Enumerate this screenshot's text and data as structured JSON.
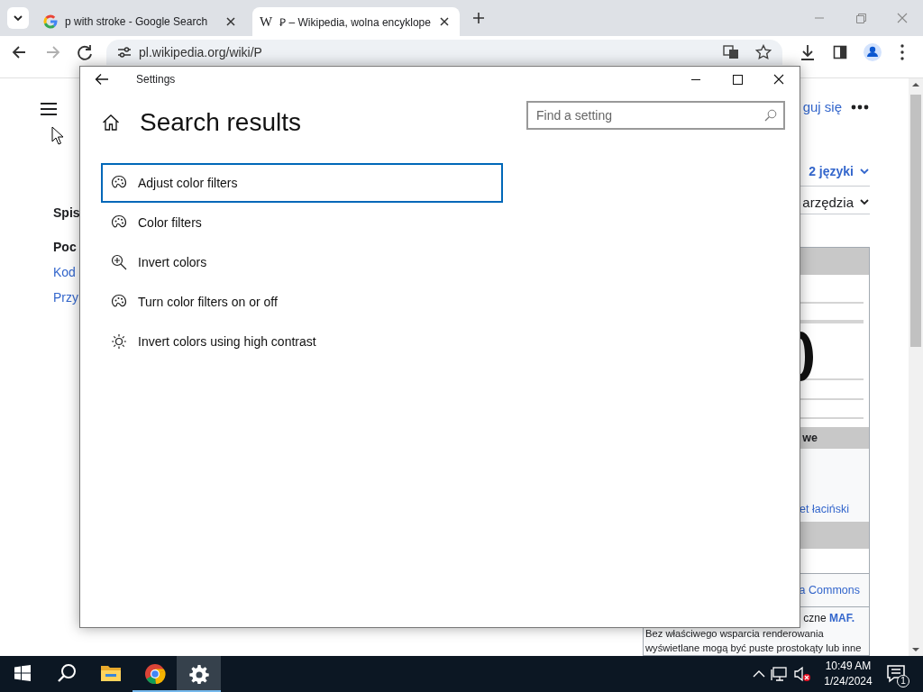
{
  "browser": {
    "tabs": [
      {
        "title": "p with stroke - Google Search",
        "selected": false
      },
      {
        "favicon": "W",
        "title": "Ꝑ – Wikipedia, wolna encyklope",
        "selected": true
      }
    ],
    "navigation": [
      {
        "kind": "back",
        "disabled": false
      },
      {
        "kind": "forward",
        "disabled": true
      },
      {
        "kind": "reload",
        "disabled": false
      }
    ],
    "address": "pl.wikipedia.org/wiki/P"
  },
  "page": {
    "sidebar": [
      {
        "kind": "heading",
        "text": "Spis"
      },
      {
        "kind": "heading",
        "text": "Poc"
      },
      {
        "kind": "link",
        "text": "Kod"
      },
      {
        "kind": "link",
        "text": "Przy"
      }
    ],
    "login": "guj się",
    "languages": "2 języki",
    "tools": "arzędzia",
    "infobox": [
      {
        "kind": "band"
      },
      {
        "kind": "figure"
      },
      {
        "kind": "band",
        "text": "we"
      },
      {
        "kind": "link",
        "text": "et łaciński"
      },
      {
        "kind": "band"
      },
      {
        "kind": "blank"
      },
      {
        "kind": "link",
        "text": "a Commons"
      },
      {
        "kind": "note",
        "text": "czne **MAF.**"
      },
      {
        "kind": "paragraph",
        "text": "Bez właściwego wsparcia renderowania wyświetlane mogą być puste prostokąty lub inne"
      }
    ]
  },
  "settings": {
    "title": "Settings",
    "heading": "Search results",
    "search": {
      "placeholder": "Find a setting"
    },
    "results": [
      {
        "kind": "palette",
        "label": "Adjust color filters",
        "selected": true
      },
      {
        "kind": "palette",
        "label": "Color filters",
        "selected": false
      },
      {
        "kind": "zoom",
        "label": "Invert colors",
        "selected": false
      },
      {
        "kind": "palette",
        "label": "Turn color filters on or off",
        "selected": false
      },
      {
        "kind": "brightness",
        "label": "Invert colors using high contrast",
        "selected": false
      }
    ]
  },
  "taskbar": {
    "apps": [
      {
        "kind": "start",
        "running": false,
        "active": false
      },
      {
        "kind": "search",
        "running": false,
        "active": false
      },
      {
        "kind": "explorer",
        "running": false,
        "active": false
      },
      {
        "kind": "chrome",
        "running": true,
        "active": false
      },
      {
        "kind": "settings",
        "running": true,
        "active": true
      }
    ],
    "clock": {
      "time": "10:49 AM",
      "date": "1/24/2024"
    },
    "notifications": "1"
  }
}
